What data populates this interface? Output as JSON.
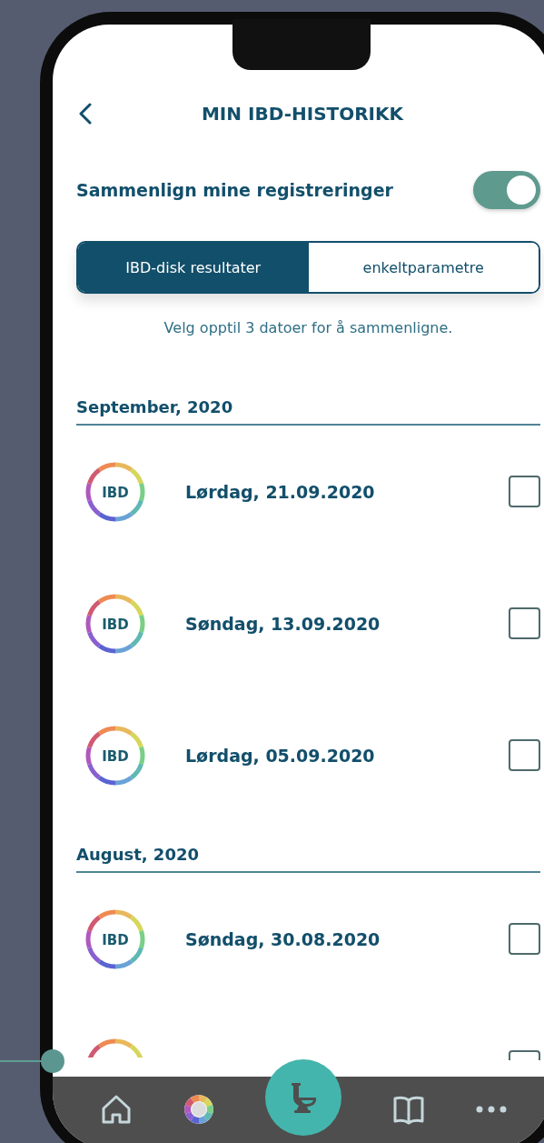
{
  "header": {
    "title": "MIN IBD-HISTORIKK"
  },
  "compare": {
    "label": "Sammenlign mine registreringer",
    "on": true
  },
  "tabs": [
    {
      "label": "IBD-disk resultater",
      "selected": true
    },
    {
      "label": "enkeltparametre",
      "selected": false
    }
  ],
  "hint": "Velg opptil 3 datoer for å sammenligne.",
  "sections": [
    {
      "month": "September, 2020",
      "entries": [
        {
          "ring_label": "IBD",
          "date": "Lørdag, 21.09.2020",
          "checked": false
        },
        {
          "ring_label": "IBD",
          "date": "Søndag, 13.09.2020",
          "checked": false
        },
        {
          "ring_label": "IBD",
          "date": "Lørdag, 05.09.2020",
          "checked": false
        }
      ]
    },
    {
      "month": "August, 2020",
      "entries": [
        {
          "ring_label": "IBD",
          "date": "Søndag, 30.08.2020",
          "checked": false
        },
        {
          "checked": false
        }
      ]
    }
  ],
  "nav": [
    {
      "kind": "home",
      "selected": false
    },
    {
      "kind": "disk",
      "selected": false
    },
    {
      "kind": "toilet",
      "selected": true
    },
    {
      "kind": "book",
      "selected": false
    },
    {
      "kind": "more",
      "selected": false
    }
  ]
}
